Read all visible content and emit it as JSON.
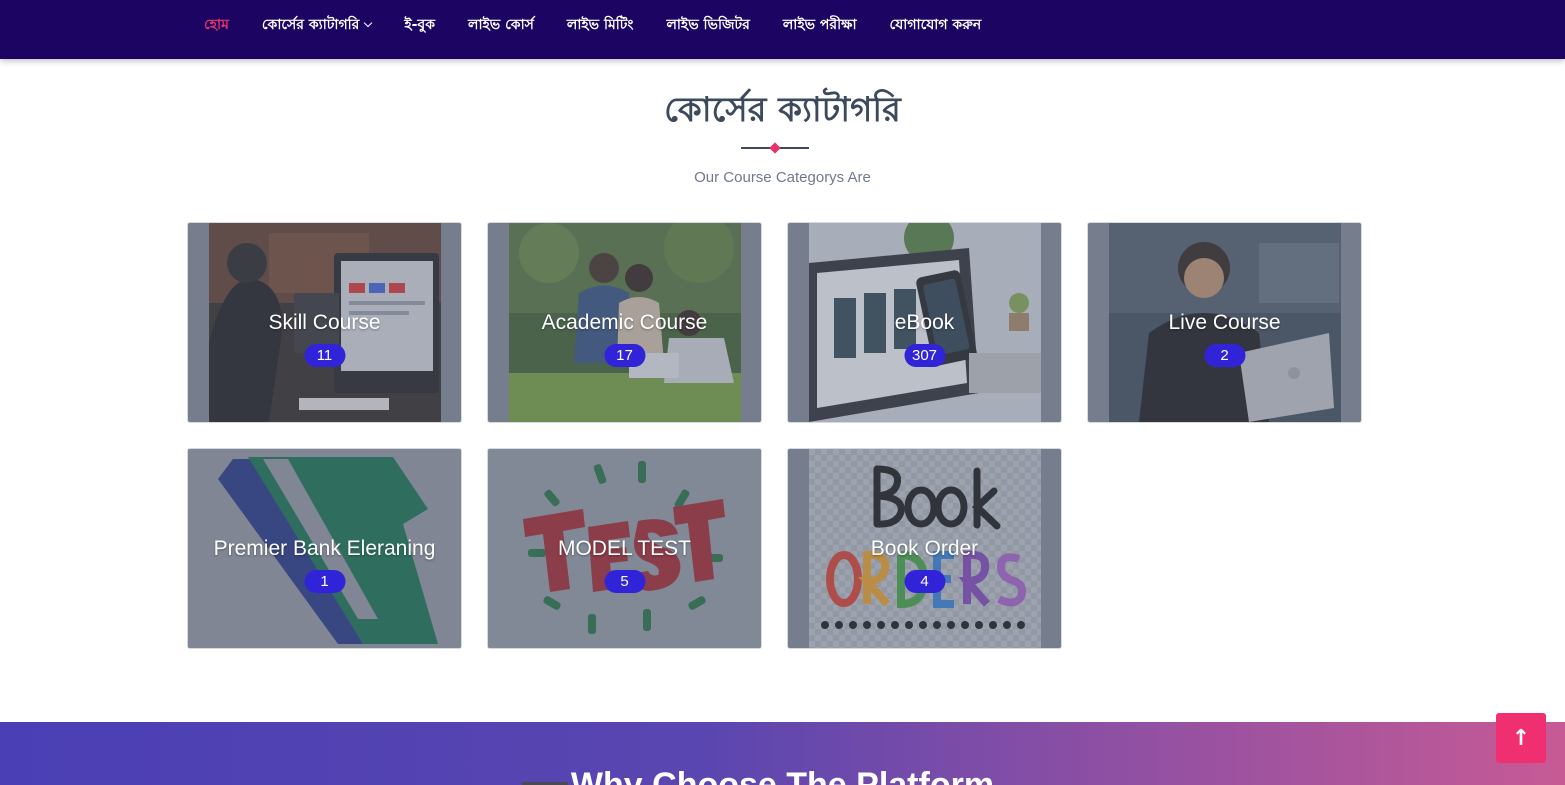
{
  "nav": {
    "items": [
      {
        "label": "হোম",
        "active": true
      },
      {
        "label": "কোর্সের ক্যাটাগরি",
        "dropdown": true
      },
      {
        "label": "ই-বুক"
      },
      {
        "label": "লাইভ কোর্স"
      },
      {
        "label": "লাইভ মিটিং"
      },
      {
        "label": "লাইভ ভিজিটর"
      },
      {
        "label": "লাইভ পরীক্ষা"
      },
      {
        "label": "যোগাযোগ করুন"
      }
    ]
  },
  "section": {
    "title": "কোর্সের ক্যাটাগরি",
    "subtitle": "Our Course Categorys Are"
  },
  "categories": [
    {
      "title": "Skill Course",
      "count": "11",
      "image": "person-at-computer-image"
    },
    {
      "title": "Academic Course",
      "count": "17",
      "image": "students-on-grass-image"
    },
    {
      "title": "eBook",
      "count": "307",
      "image": "phone-and-laptop-image"
    },
    {
      "title": "Live Course",
      "count": "2",
      "image": "man-with-headphones-image"
    },
    {
      "title": "Premier Bank Eleraning",
      "count": "1",
      "image": "premier-bank-logo-image"
    },
    {
      "title": "MODEL TEST",
      "count": "5",
      "image": "test-3d-text-image"
    },
    {
      "title": "Book Order",
      "count": "4",
      "image": "book-orders-text-image"
    }
  ],
  "why": {
    "title": "Why Choose The Platform"
  },
  "colors": {
    "navbar": "#1c0462",
    "accent": "#e8326e",
    "badge": "#3124d8",
    "heading": "#3d4a5e"
  },
  "scroll_top": {
    "icon": "arrow-up-icon",
    "glyph": "↑"
  }
}
